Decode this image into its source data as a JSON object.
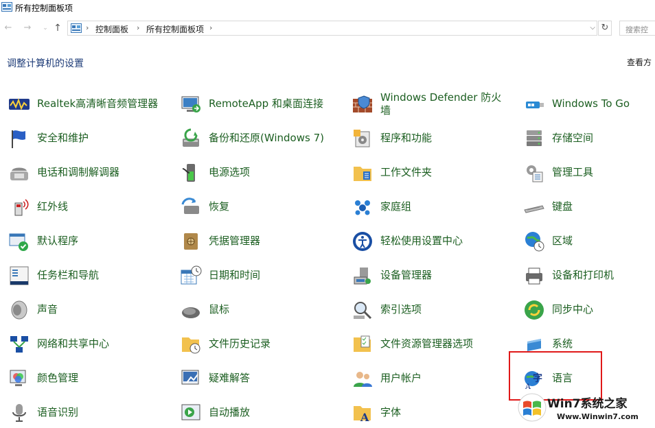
{
  "window": {
    "title": "所有控制面板项"
  },
  "address": {
    "breadcrumbs": [
      "控制面板",
      "所有控制面板项"
    ],
    "search_placeholder": "搜索控"
  },
  "header": {
    "heading": "调整计算机的设置",
    "view_by": "查看方"
  },
  "items": [
    [
      "Realtek高清晰音频管理器",
      "RemoteApp 和桌面连接",
      "Windows Defender 防火墙",
      "Windows To Go"
    ],
    [
      "安全和维护",
      "备份和还原(Windows 7)",
      "程序和功能",
      "存储空间"
    ],
    [
      "电话和调制解调器",
      "电源选项",
      "工作文件夹",
      "管理工具"
    ],
    [
      "红外线",
      "恢复",
      "家庭组",
      "键盘"
    ],
    [
      "默认程序",
      "凭据管理器",
      "轻松使用设置中心",
      "区域"
    ],
    [
      "任务栏和导航",
      "日期和时间",
      "设备管理器",
      "设备和打印机"
    ],
    [
      "声音",
      "鼠标",
      "索引选项",
      "同步中心"
    ],
    [
      "网络和共享中心",
      "文件历史记录",
      "文件资源管理器选项",
      "系统"
    ],
    [
      "颜色管理",
      "疑难解答",
      "用户帐户",
      "语言"
    ],
    [
      "语音识别",
      "自动播放",
      "字体",
      ""
    ]
  ],
  "watermark": {
    "title": "Win7系统之家",
    "url": "Www.Winwin7.com"
  },
  "colors": {
    "link_green": "#1b5e20",
    "heading_blue": "#1e3c78",
    "highlight_red": "#e01818"
  }
}
